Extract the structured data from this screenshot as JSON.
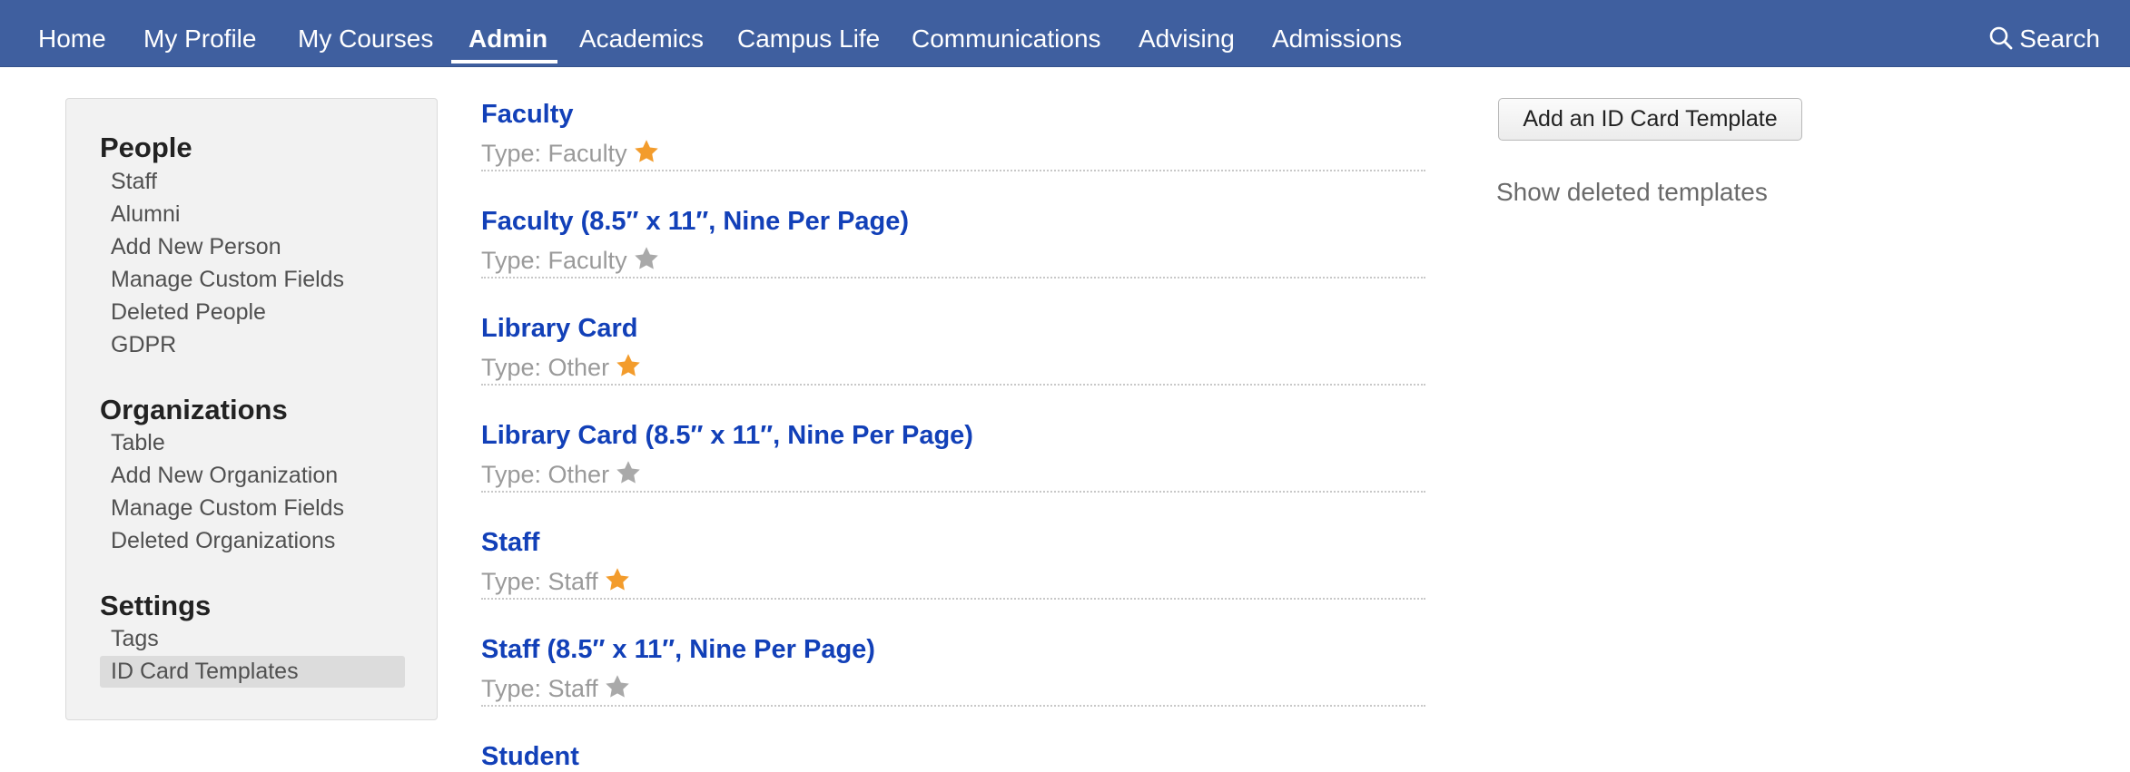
{
  "nav": {
    "items": [
      "Home",
      "My Profile",
      "My Courses",
      "Admin",
      "Academics",
      "Campus Life",
      "Communications",
      "Advising",
      "Admissions"
    ],
    "active": "Admin",
    "search_label": "Search"
  },
  "sidebar": {
    "people": {
      "heading": "People",
      "links": [
        "Staff",
        "Alumni",
        "Add New Person",
        "Manage Custom Fields",
        "Deleted People",
        "GDPR"
      ]
    },
    "organizations": {
      "heading": "Organizations",
      "links": [
        "Table",
        "Add New Organization",
        "Manage Custom Fields",
        "Deleted Organizations"
      ]
    },
    "settings": {
      "heading": "Settings",
      "links": [
        "Tags",
        "ID Card Templates"
      ],
      "active": "ID Card Templates"
    }
  },
  "templates": [
    {
      "title": "Faculty",
      "type": "Type: Faculty",
      "starred": true
    },
    {
      "title": "Faculty (8.5″ x 11″, Nine Per Page)",
      "type": "Type: Faculty",
      "starred": false
    },
    {
      "title": "Library Card",
      "type": "Type: Other",
      "starred": true
    },
    {
      "title": "Library Card (8.5″ x 11″, Nine Per Page)",
      "type": "Type: Other",
      "starred": false
    },
    {
      "title": "Staff",
      "type": "Type: Staff",
      "starred": true
    },
    {
      "title": "Staff (8.5″ x 11″, Nine Per Page)",
      "type": "Type: Staff",
      "starred": false
    },
    {
      "title": "Student",
      "type": "",
      "starred": false
    }
  ],
  "actions": {
    "add_button": "Add an ID Card Template",
    "show_deleted": "Show deleted templates"
  },
  "colors": {
    "nav_bg": "#3f5f9f",
    "link": "#1240b8",
    "star_on": "#f39c2c",
    "star_off": "#a9a9a9"
  },
  "icons": {
    "search": "search-icon",
    "star": "star-icon"
  }
}
